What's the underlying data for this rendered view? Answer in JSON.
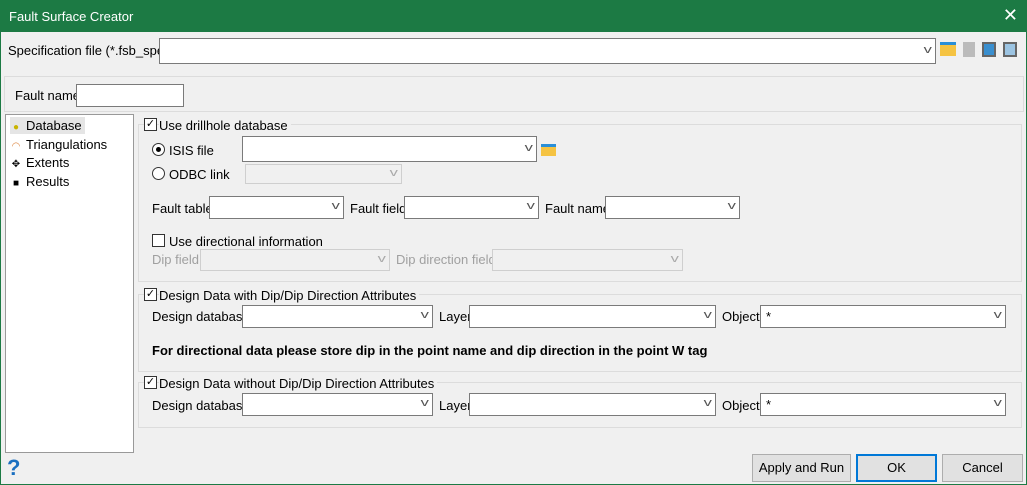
{
  "window": {
    "title": "Fault Surface Creator",
    "close": "✕"
  },
  "spec": {
    "label": "Specification file (*.fsb_spec)",
    "value": ""
  },
  "fault_name": {
    "label": "Fault name",
    "value": ""
  },
  "tree": [
    {
      "label": "Database",
      "icon": "database-icon"
    },
    {
      "label": "Triangulations",
      "icon": "triangulation-icon"
    },
    {
      "label": "Extents",
      "icon": "move-arrows-icon"
    },
    {
      "label": "Results",
      "icon": "save-disk-icon"
    }
  ],
  "drillhole": {
    "label": "Use drillhole database",
    "checked": true,
    "isis_label": "ISIS file",
    "isis_selected": true,
    "odbc_label": "ODBC link",
    "fault_table": "Fault table",
    "fault_field": "Fault field",
    "fault_name": "Fault name",
    "directional": "Use directional information",
    "dip_field": "Dip field",
    "dip_direction_field": "Dip direction field"
  },
  "design_with": {
    "label": "Design Data with Dip/Dip Direction Attributes",
    "checked": true,
    "db": "Design database",
    "layer": "Layer",
    "object": "Object",
    "object_value": "*",
    "note": "For directional data please store dip in the point name and dip direction in the point W tag"
  },
  "design_without": {
    "label": "Design Data without Dip/Dip Direction Attributes",
    "checked": true,
    "db": "Design database",
    "layer": "Layer",
    "object": "Object",
    "object_value": "*"
  },
  "buttons": {
    "apply": "Apply and Run",
    "ok": "OK",
    "cancel": "Cancel",
    "help": "?"
  },
  "colors": {
    "titlebar": "#1c7a44",
    "accent": "#0078d7"
  }
}
